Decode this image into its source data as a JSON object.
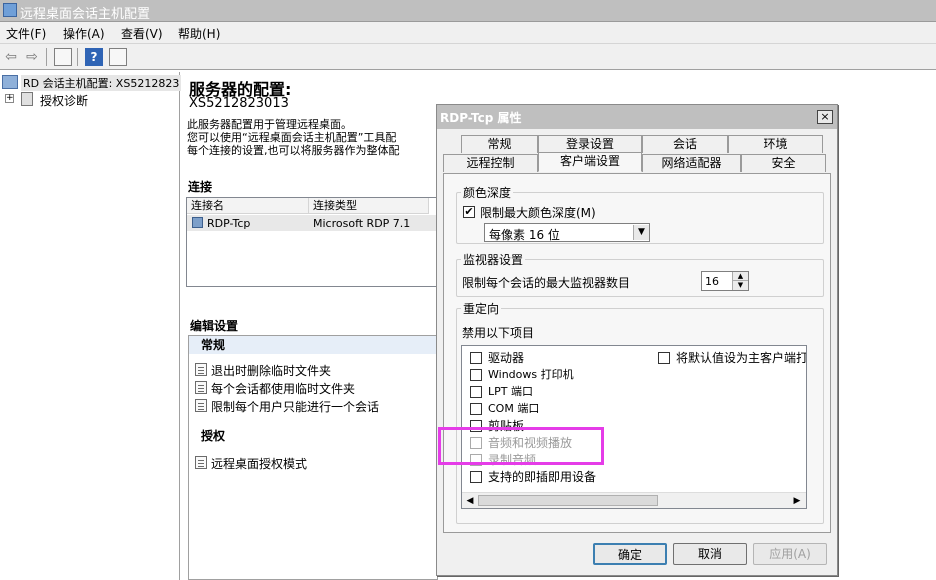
{
  "window": {
    "title": "远程桌面会话主机配置"
  },
  "menu": [
    "文件(F)",
    "操作(A)",
    "查看(V)",
    "帮助(H)"
  ],
  "toolbar": {
    "back_icon": "back-arrow-icon",
    "forward_icon": "forward-arrow-icon",
    "help_label": "?"
  },
  "tree": {
    "root": "RD 会话主机配置: XS5212823",
    "child": "授权诊断"
  },
  "main": {
    "heading": "服务器的配置:",
    "server_name": "XS5212823013",
    "desc_lines": [
      "此服务器配置用于管理远程桌面。",
      "您可以使用“远程桌面会话主机配置”工具配",
      "每个连接的设置,也可以将服务器作为整体配"
    ],
    "connections_label": "连接",
    "connections": {
      "columns": [
        "连接名",
        "连接类型"
      ],
      "rows": [
        {
          "name": "RDP-Tcp",
          "type": "Microsoft RDP 7.1"
        }
      ]
    },
    "edit_settings_label": "编辑设置",
    "groups": [
      {
        "title": "常规",
        "items": [
          "退出时删除临时文件夹",
          "每个会话都使用临时文件夹",
          "限制每个用户只能进行一个会话"
        ]
      },
      {
        "title": "授权",
        "items": [
          "远程桌面授权模式"
        ]
      }
    ]
  },
  "dialog": {
    "title": "RDP-Tcp 属性",
    "close_label": "×",
    "tabs_row1": [
      "常规",
      "登录设置",
      "会话",
      "环境"
    ],
    "tabs_row2": [
      "远程控制",
      "客户端设置",
      "网络适配器",
      "安全"
    ],
    "selected_tab": "客户端设置",
    "color_depth": {
      "legend": "颜色深度",
      "limit_label": "限制最大颜色深度(M)",
      "limit_checked": true,
      "select_value": "每像素 16 位"
    },
    "monitor": {
      "legend": "监视器设置",
      "label": "限制每个会话的最大监视器数目",
      "value": "16"
    },
    "redirect": {
      "legend": "重定向",
      "disable_label": "禁用以下项目",
      "items_left": [
        {
          "label": "驱动器",
          "checked": false,
          "disabled": false
        },
        {
          "label": "Windows 打印机",
          "checked": false,
          "disabled": false
        },
        {
          "label": "LPT 端口",
          "checked": false,
          "disabled": false
        },
        {
          "label": "COM 端口",
          "checked": false,
          "disabled": false
        },
        {
          "label": "剪贴板",
          "checked": false,
          "disabled": false
        },
        {
          "label": "音频和视频播放",
          "checked": false,
          "disabled": true
        },
        {
          "label": "录制音频",
          "checked": false,
          "disabled": true
        },
        {
          "label": "支持的即插即用设备",
          "checked": false,
          "disabled": false
        }
      ],
      "items_right": [
        {
          "label": "将默认值设为主客户端打",
          "checked": false,
          "disabled": false
        }
      ]
    },
    "buttons": {
      "ok": "确定",
      "cancel": "取消",
      "apply": "应用(A)"
    }
  },
  "colors": {
    "highlight": "#e53ce8",
    "default_button_border": "#3c7fb1"
  }
}
